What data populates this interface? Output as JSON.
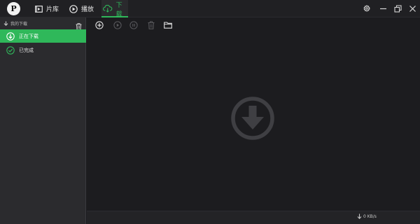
{
  "app": {
    "logo_letter": "P",
    "nav_tabs": [
      {
        "label": "片库",
        "icon": "film-icon"
      },
      {
        "label": "播放",
        "icon": "play-circle-icon"
      },
      {
        "label": "下载",
        "icon": "cloud-download-icon"
      }
    ],
    "active_tab": "下载",
    "window_controls": [
      "gear-icon",
      "minimize-icon",
      "restore-icon",
      "close-icon"
    ],
    "accent_color": "#2fb85a"
  },
  "sidebar": {
    "header": "我的下载",
    "items": [
      {
        "label": "正在下载",
        "icon": "download-circle-icon",
        "active": true
      },
      {
        "label": "已完成",
        "icon": "check-circle-icon",
        "active": false
      }
    ]
  },
  "toolbar": {
    "buttons": [
      "add-icon",
      "start-icon",
      "pause-icon",
      "delete-icon",
      "folder-icon"
    ]
  },
  "status": {
    "speed": "0 KB/s"
  }
}
